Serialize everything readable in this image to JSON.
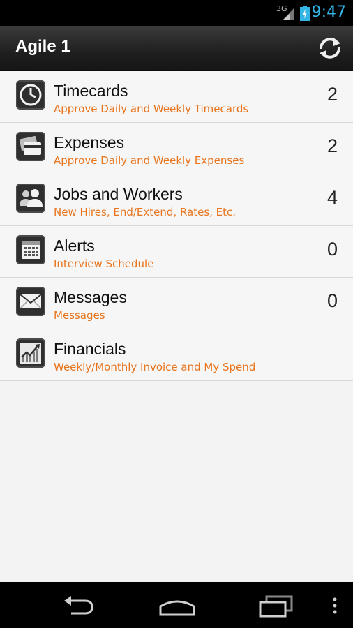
{
  "status_bar": {
    "network": "3G",
    "time": "9:47",
    "accent_color": "#33b5e5"
  },
  "action_bar": {
    "title": "Agile 1",
    "refresh_icon": "refresh-icon"
  },
  "menu": {
    "accent_color": "#e8741d",
    "items": [
      {
        "label": "Timecards",
        "subtitle": "Approve Daily and Weekly Timecards",
        "count": "2",
        "icon": "clock-icon"
      },
      {
        "label": "Expenses",
        "subtitle": "Approve Daily and Weekly Expenses",
        "count": "2",
        "icon": "credit-card-icon"
      },
      {
        "label": "Jobs and Workers",
        "subtitle": "New Hires, End/Extend, Rates, Etc.",
        "count": "4",
        "icon": "people-icon"
      },
      {
        "label": "Alerts",
        "subtitle": "Interview Schedule",
        "count": "0",
        "icon": "calendar-icon"
      },
      {
        "label": "Messages",
        "subtitle": "Messages",
        "count": "0",
        "icon": "envelope-icon"
      },
      {
        "label": "Financials",
        "subtitle": "Weekly/Monthly Invoice and My Spend",
        "count": "",
        "icon": "chart-icon"
      }
    ]
  },
  "nav_bar": {
    "icons": [
      "back-icon",
      "home-icon",
      "recent-apps-icon",
      "overflow-menu-icon"
    ]
  }
}
